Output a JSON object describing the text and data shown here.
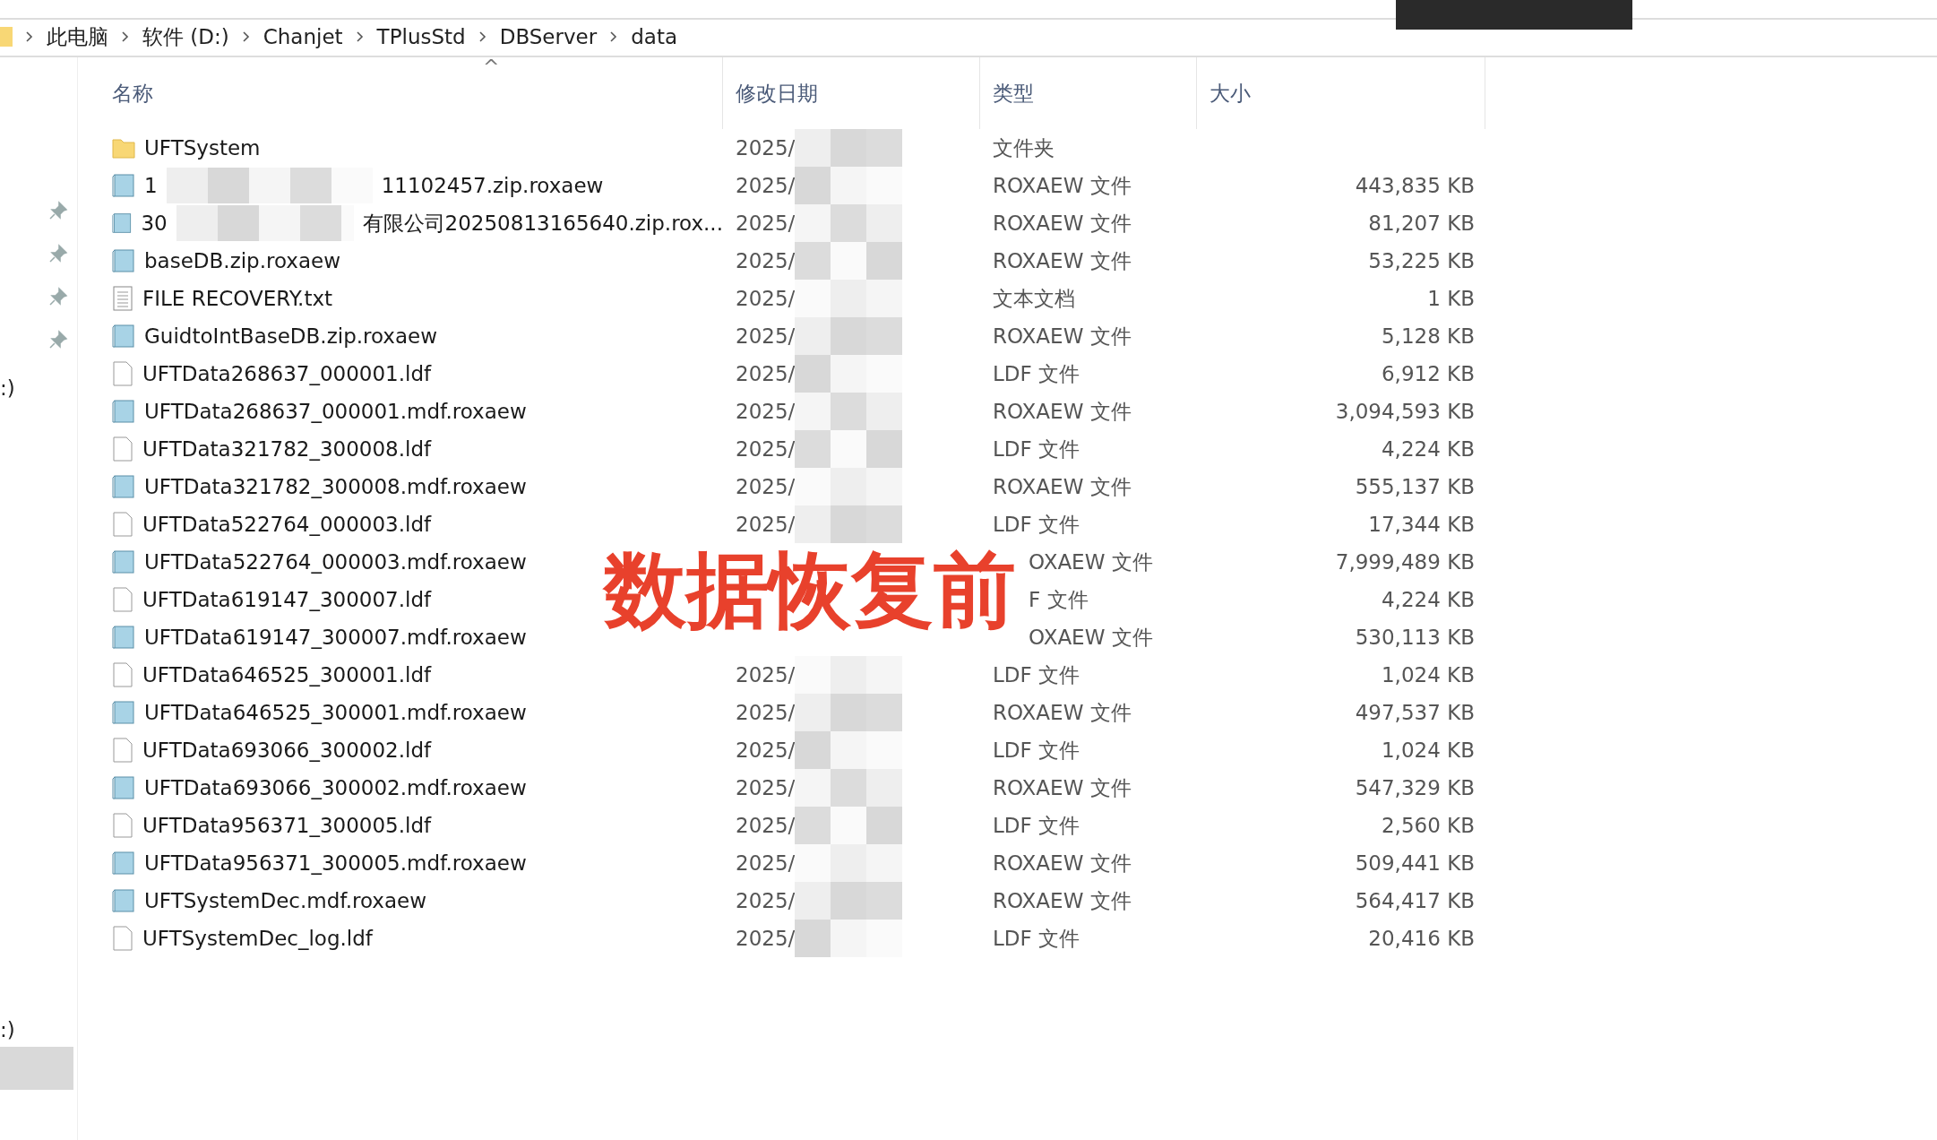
{
  "breadcrumb": [
    "此电脑",
    "软件 (D:)",
    "Chanjet",
    "TPlusStd",
    "DBServer",
    "data"
  ],
  "nav": {
    "drives": [
      ":)",
      ":)"
    ]
  },
  "columns": [
    "名称",
    "修改日期",
    "类型",
    "大小"
  ],
  "sort_indicator": "^",
  "rows": [
    {
      "kind": "folder",
      "name": "UFTSystem",
      "date": "2025/",
      "type": "文件夹"
    },
    {
      "kind": "archive",
      "name": "1",
      "name_redacted": true,
      "name_end": "11102457.zip.roxaew",
      "date": "2025/",
      "type": "ROXAEW 文件",
      "size": "443,835 KB"
    },
    {
      "kind": "archive",
      "name": "30",
      "name_redacted": true,
      "name_end": "有限公司20250813165640.zip.rox...",
      "date": "2025/",
      "type": "ROXAEW 文件",
      "size": "81,207 KB"
    },
    {
      "kind": "archive",
      "name": "baseDB.zip.roxaew",
      "date": "2025/",
      "type": "ROXAEW 文件",
      "size": "53,225 KB"
    },
    {
      "kind": "text",
      "name": "FILE RECOVERY.txt",
      "date": "2025/",
      "type": "文本文档",
      "size": "1 KB"
    },
    {
      "kind": "archive",
      "name": "GuidtoIntBaseDB.zip.roxaew",
      "date": "2025/",
      "type": "ROXAEW 文件",
      "size": "5,128 KB"
    },
    {
      "kind": "file",
      "name": "UFTData268637_000001.ldf",
      "date": "2025/",
      "type": "LDF 文件",
      "size": "6,912 KB"
    },
    {
      "kind": "archive",
      "name": "UFTData268637_000001.mdf.roxaew",
      "date": "2025/",
      "type": "ROXAEW 文件",
      "size": "3,094,593 KB"
    },
    {
      "kind": "file",
      "name": "UFTData321782_300008.ldf",
      "date": "2025/",
      "type": "LDF 文件",
      "size": "4,224 KB"
    },
    {
      "kind": "archive",
      "name": "UFTData321782_300008.mdf.roxaew",
      "date": "2025/",
      "type": "ROXAEW 文件",
      "size": "555,137 KB"
    },
    {
      "kind": "file",
      "name": "UFTData522764_000003.ldf",
      "date": "2025/",
      "type": "LDF 文件",
      "size": "17,344 KB"
    },
    {
      "kind": "archive",
      "name": "UFTData522764_000003.mdf.roxaew",
      "covered": true,
      "type": "OXAEW 文件",
      "size": "7,999,489 KB"
    },
    {
      "kind": "file",
      "name": "UFTData619147_300007.ldf",
      "covered": true,
      "type": "F 文件",
      "size": "4,224 KB"
    },
    {
      "kind": "archive",
      "name": "UFTData619147_300007.mdf.roxaew",
      "covered": true,
      "type": "OXAEW 文件",
      "size": "530,113 KB"
    },
    {
      "kind": "file",
      "name": "UFTData646525_300001.ldf",
      "date": "2025/",
      "type": "LDF 文件",
      "size": "1,024 KB"
    },
    {
      "kind": "archive",
      "name": "UFTData646525_300001.mdf.roxaew",
      "date": "2025/",
      "type": "ROXAEW 文件",
      "size": "497,537 KB"
    },
    {
      "kind": "file",
      "name": "UFTData693066_300002.ldf",
      "date": "2025/",
      "type": "LDF 文件",
      "size": "1,024 KB"
    },
    {
      "kind": "archive",
      "name": "UFTData693066_300002.mdf.roxaew",
      "date": "2025/",
      "type": "ROXAEW 文件",
      "size": "547,329 KB"
    },
    {
      "kind": "file",
      "name": "UFTData956371_300005.ldf",
      "date": "2025/",
      "type": "LDF 文件",
      "size": "2,560 KB"
    },
    {
      "kind": "archive",
      "name": "UFTData956371_300005.mdf.roxaew",
      "date": "2025/",
      "type": "ROXAEW 文件",
      "size": "509,441 KB"
    },
    {
      "kind": "archive",
      "name": "UFTSystemDec.mdf.roxaew",
      "date": "2025/",
      "type": "ROXAEW 文件",
      "size": "564,417 KB"
    },
    {
      "kind": "file",
      "name": "UFTSystemDec_log.ldf",
      "date": "2025/",
      "type": "LDF 文件",
      "size": "20,416 KB"
    }
  ],
  "annotation": "数据恢复前"
}
